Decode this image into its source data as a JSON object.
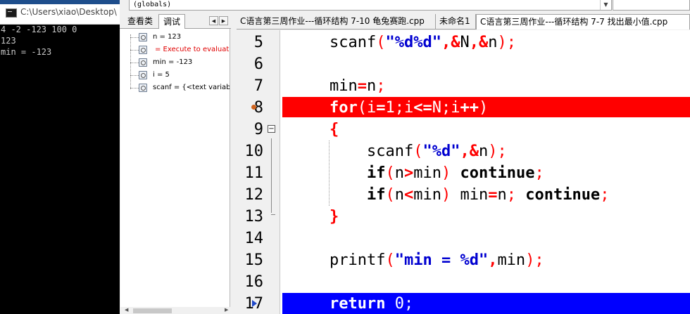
{
  "console": {
    "title": "C:\\Users\\xiao\\Desktop\\",
    "lines": [
      "4 -2 -123 100 0",
      "123",
      "min = -123"
    ],
    "background": "#000000"
  },
  "toolbar": {
    "globals_combo": "(globals)"
  },
  "left_panel": {
    "tabs": [
      "查看类",
      "调试"
    ],
    "active_tab": "调试",
    "watches": [
      "n = 123",
      "= Execute to evaluat",
      "min = -123",
      "i = 5",
      "scanf = {<text variabl"
    ]
  },
  "editor": {
    "tabs": [
      "C语言第三周作业---循环结构 7-10 龟兔赛跑.cpp",
      "未命名1",
      "C语言第三周作业---循环结构 7-7 找出最小值.cpp"
    ],
    "active_tab": 2,
    "breakpoint_line": 8,
    "execution_line": 17,
    "lines": [
      {
        "num": "5",
        "text": "    scanf(\"%d%d\",&N,&n);"
      },
      {
        "num": "6",
        "text": ""
      },
      {
        "num": "7",
        "text": "    min=n;"
      },
      {
        "num": "8",
        "text": "    for(i=1;i<=N;i++)"
      },
      {
        "num": "9",
        "text": "    {"
      },
      {
        "num": "10",
        "text": "        scanf(\"%d\",&n);"
      },
      {
        "num": "11",
        "text": "        if(n>min) continue;"
      },
      {
        "num": "12",
        "text": "        if(n<min) min=n; continue;"
      },
      {
        "num": "13",
        "text": "    }"
      },
      {
        "num": "14",
        "text": ""
      },
      {
        "num": "15",
        "text": "    printf(\"min = %d\",min);"
      },
      {
        "num": "16",
        "text": ""
      },
      {
        "num": "17",
        "text": "    return 0;"
      }
    ],
    "colors": {
      "breakpoint_line": "#ff0000",
      "execution_line": "#0000ff",
      "operator": "#ff0000",
      "string": "#0000d0"
    }
  }
}
